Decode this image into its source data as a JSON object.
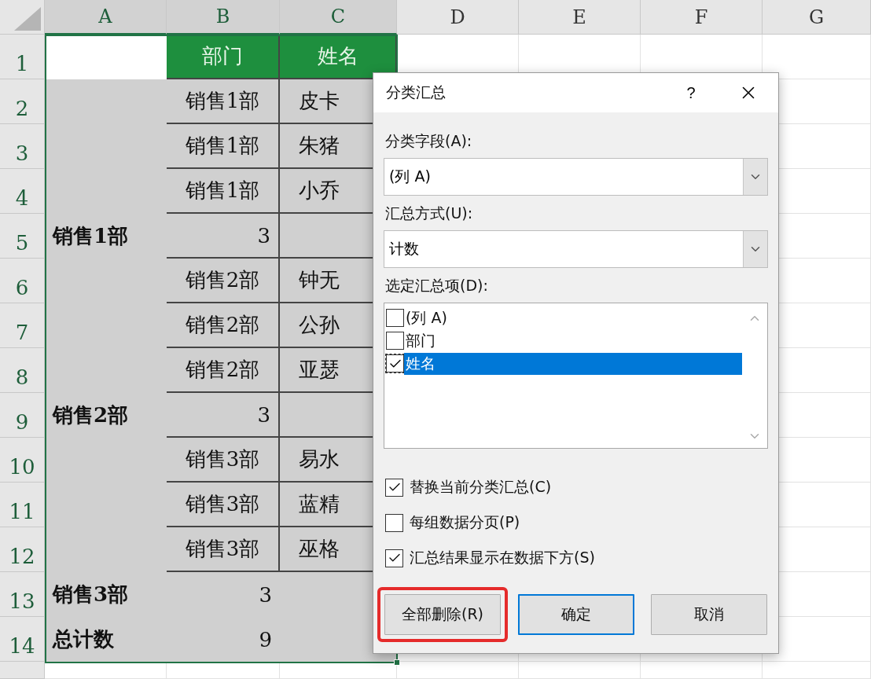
{
  "sheet": {
    "columns": [
      {
        "label": "A",
        "selected": true
      },
      {
        "label": "B",
        "selected": true
      },
      {
        "label": "C",
        "selected": true
      },
      {
        "label": "D",
        "selected": false
      },
      {
        "label": "E",
        "selected": false
      },
      {
        "label": "F",
        "selected": false
      },
      {
        "label": "G",
        "selected": false
      }
    ],
    "rows": [
      {
        "number": "1",
        "kind": "header",
        "b": "部门",
        "c": "姓名"
      },
      {
        "number": "2",
        "kind": "item",
        "b": "销售1部",
        "c": "皮卡"
      },
      {
        "number": "3",
        "kind": "item",
        "b": "销售1部",
        "c": "朱猪"
      },
      {
        "number": "4",
        "kind": "item",
        "b": "销售1部",
        "c": "小乔"
      },
      {
        "number": "5",
        "kind": "subtotal",
        "a": "销售1部",
        "b": "3"
      },
      {
        "number": "6",
        "kind": "item",
        "b": "销售2部",
        "c": "钟无"
      },
      {
        "number": "7",
        "kind": "item",
        "b": "销售2部",
        "c": "公孙"
      },
      {
        "number": "8",
        "kind": "item",
        "b": "销售2部",
        "c": "亚瑟"
      },
      {
        "number": "9",
        "kind": "subtotal",
        "a": "销售2部",
        "b": "3"
      },
      {
        "number": "10",
        "kind": "item",
        "b": "销售3部",
        "c": "易水"
      },
      {
        "number": "11",
        "kind": "item",
        "b": "销售3部",
        "c": "蓝精"
      },
      {
        "number": "12",
        "kind": "item",
        "b": "销售3部",
        "c": "巫格"
      },
      {
        "number": "13",
        "kind": "total",
        "a": "销售3部",
        "b": "3"
      },
      {
        "number": "14",
        "kind": "total",
        "a": "总计数",
        "b": "9"
      }
    ]
  },
  "dialog": {
    "title": "分类汇总",
    "help": "?",
    "fields": [
      {
        "label": "分类字段(A):",
        "value": "(列 A)"
      },
      {
        "label": "汇总方式(U):",
        "value": "计数"
      }
    ],
    "list": {
      "label": "选定汇总项(D):",
      "items": [
        {
          "label": "(列 A)",
          "checked": false,
          "selected": false
        },
        {
          "label": "部门",
          "checked": false,
          "selected": false
        },
        {
          "label": "姓名",
          "checked": true,
          "selected": true
        }
      ]
    },
    "options": [
      {
        "label": "替换当前分类汇总(C)",
        "checked": true
      },
      {
        "label": "每组数据分页(P)",
        "checked": false
      },
      {
        "label": "汇总结果显示在数据下方(S)",
        "checked": true
      }
    ],
    "buttons": [
      {
        "label": "全部删除(R)",
        "annotated": true,
        "default": false
      },
      {
        "label": "确定",
        "annotated": false,
        "default": true
      },
      {
        "label": "取消",
        "annotated": false,
        "default": false
      }
    ]
  }
}
